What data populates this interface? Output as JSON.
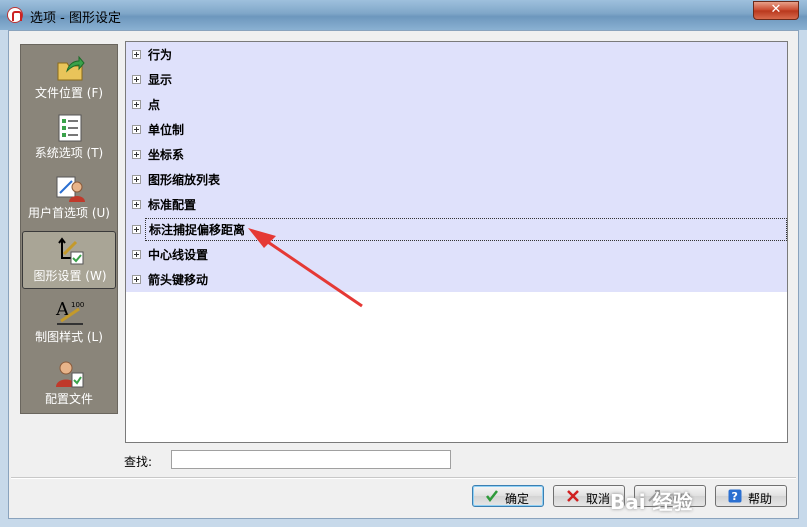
{
  "window": {
    "title": "选项 - 图形设定",
    "close_glyph": "✕"
  },
  "nav": {
    "items": [
      {
        "label": "文件位置 (F)",
        "icon": "folder-arrow-icon",
        "selected": false
      },
      {
        "label": "系统选项 (T)",
        "icon": "checklist-icon",
        "selected": false
      },
      {
        "label": "用户首选项 (U)",
        "icon": "user-settings-icon",
        "selected": false
      },
      {
        "label": "图形设置 (W)",
        "icon": "drawing-settings-icon",
        "selected": true
      },
      {
        "label": "制图样式 (L)",
        "icon": "draft-style-icon",
        "selected": false
      },
      {
        "label": "配置文件",
        "icon": "profile-icon",
        "selected": false
      }
    ]
  },
  "tree": {
    "items": [
      {
        "label": "行为"
      },
      {
        "label": "显示"
      },
      {
        "label": "点"
      },
      {
        "label": "单位制"
      },
      {
        "label": "坐标系"
      },
      {
        "label": "图形缩放列表"
      },
      {
        "label": "标准配置"
      },
      {
        "label": "标注捕捉偏移距离",
        "focused": true
      },
      {
        "label": "中心线设置"
      },
      {
        "label": "箭头键移动"
      }
    ],
    "band_color": "#dfe1fb"
  },
  "search": {
    "label": "查找:",
    "value": ""
  },
  "buttons": {
    "ok": "确定",
    "cancel": "取消",
    "apply": "应用",
    "help": "帮助"
  },
  "annotation": {
    "arrow_color": "#e53935"
  },
  "watermark": "Bai 经验"
}
